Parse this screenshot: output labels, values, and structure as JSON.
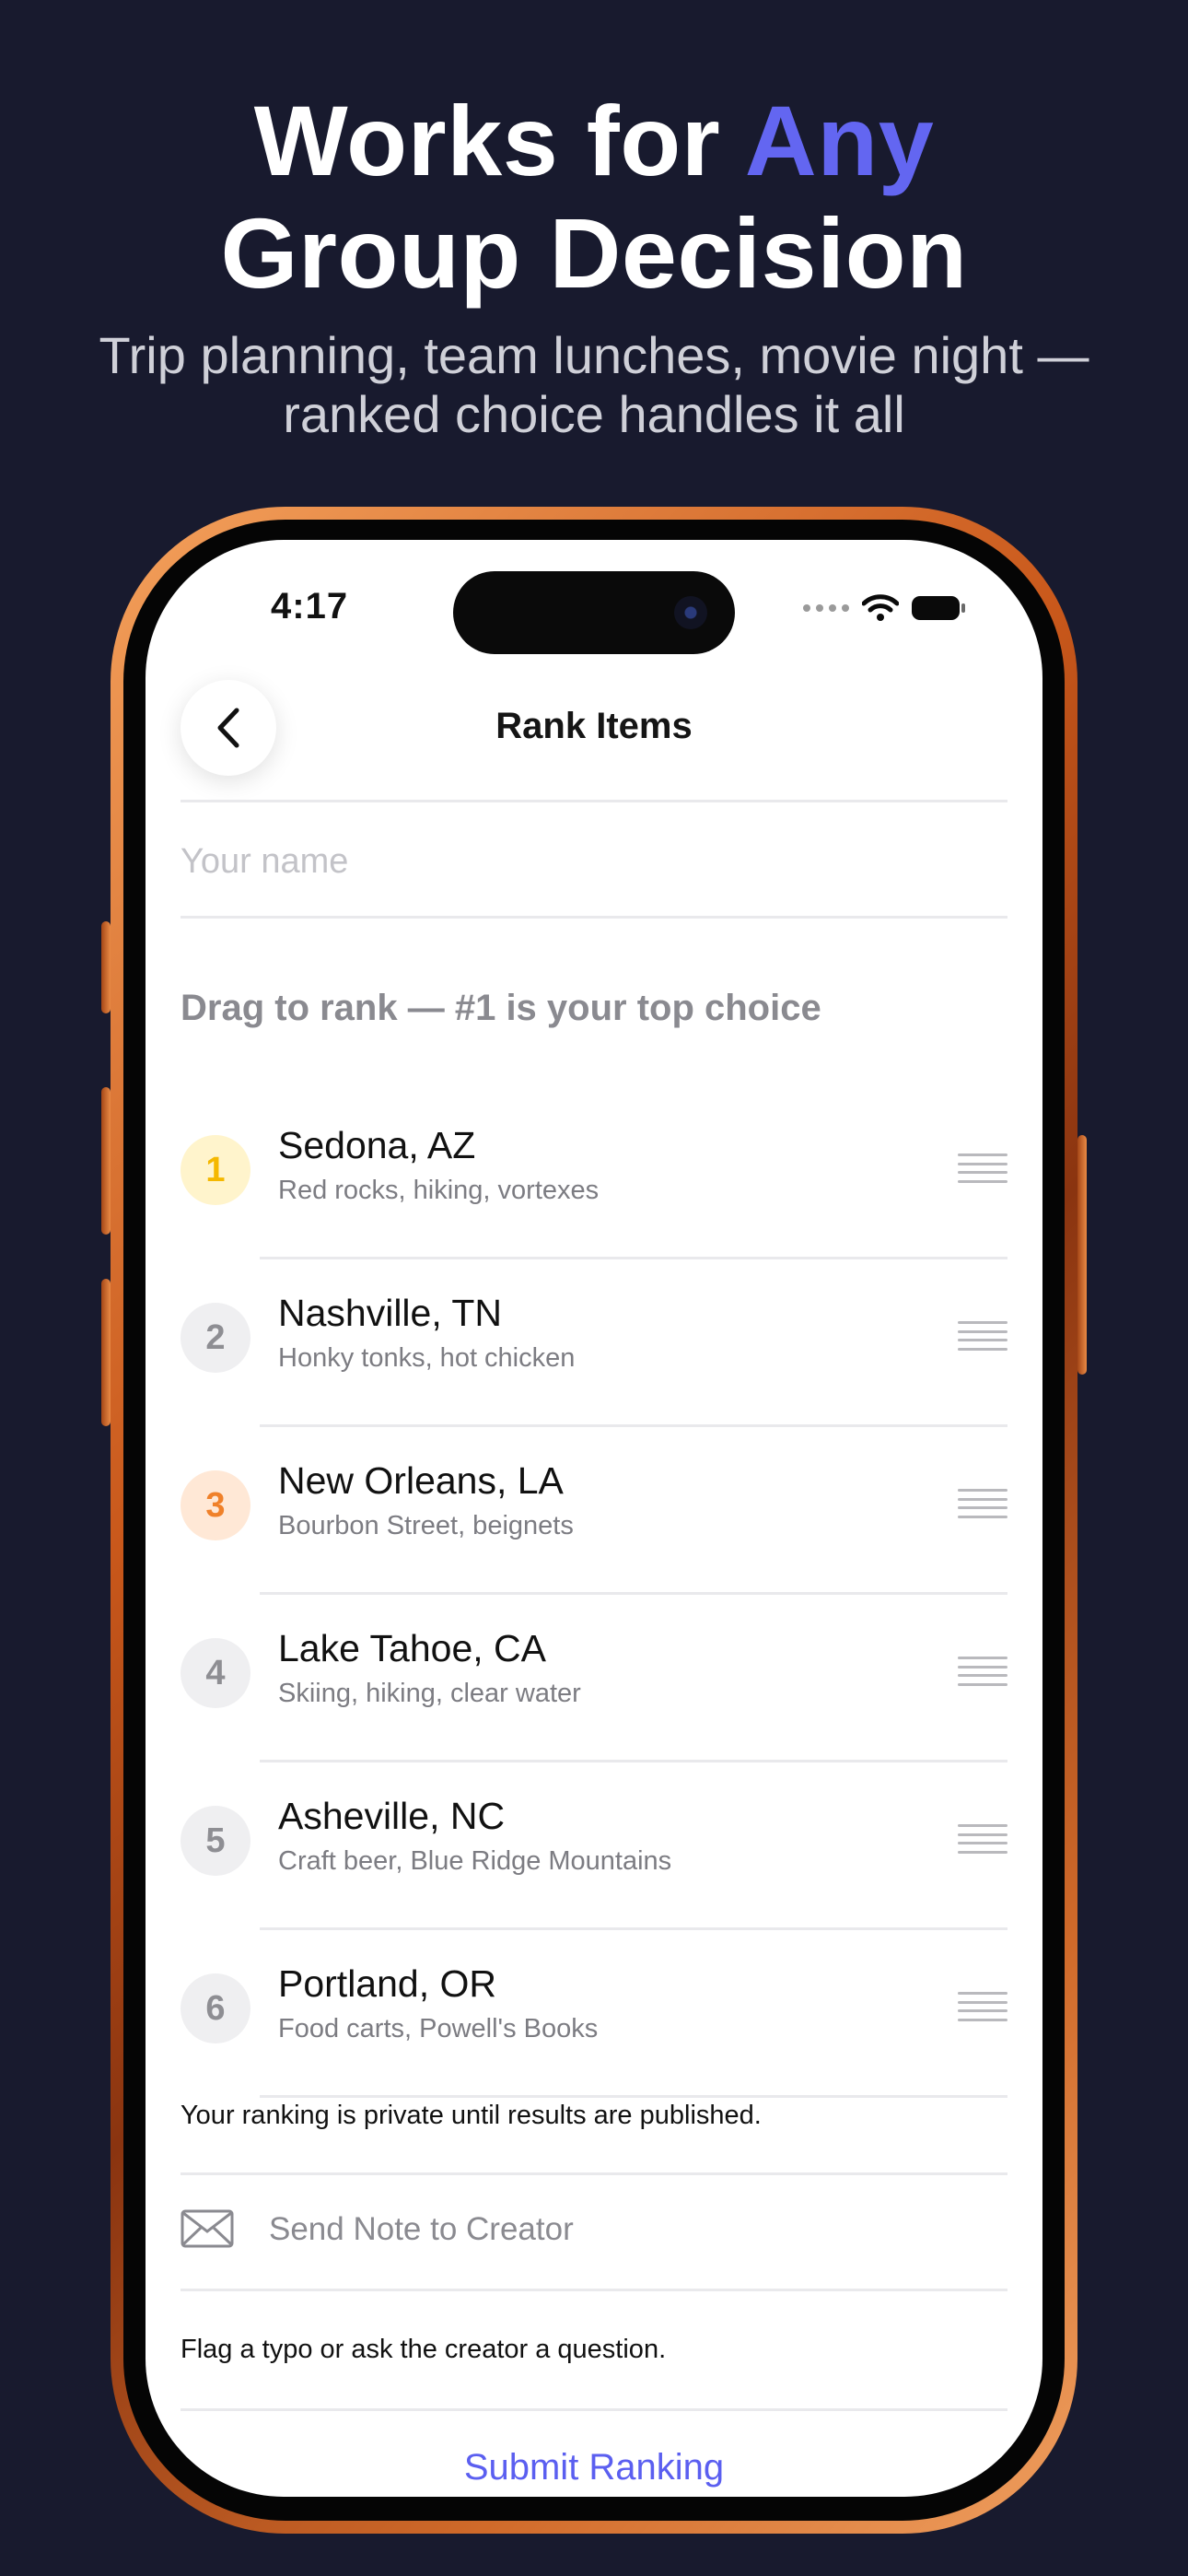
{
  "hero": {
    "title_part1": "Works for ",
    "title_accent": "Any",
    "title_line2": "Group Decision",
    "subtitle_line1": "Trip planning, team lunches, movie night —",
    "subtitle_line2": "ranked choice handles it all",
    "accent_color": "#6366f1"
  },
  "status_bar": {
    "time": "4:17"
  },
  "nav": {
    "title": "Rank Items",
    "back_icon": "chevron-left-icon"
  },
  "name_field": {
    "placeholder": "Your name",
    "value": ""
  },
  "instruction": "Drag to rank — #1 is your top choice",
  "items": [
    {
      "rank": "1",
      "title": "Sedona, AZ",
      "description": "Red rocks, hiking, vortexes",
      "badge_bg": "#fff4cc",
      "badge_color": "#f5b800"
    },
    {
      "rank": "2",
      "title": "Nashville, TN",
      "description": "Honky tonks, hot chicken",
      "badge_bg": "#efeff1",
      "badge_color": "#8e8e93"
    },
    {
      "rank": "3",
      "title": "New Orleans, LA",
      "description": "Bourbon Street, beignets",
      "badge_bg": "#ffe8d6",
      "badge_color": "#f0812a"
    },
    {
      "rank": "4",
      "title": "Lake Tahoe, CA",
      "description": "Skiing, hiking, clear water",
      "badge_bg": "#efeff1",
      "badge_color": "#8e8e93"
    },
    {
      "rank": "5",
      "title": "Asheville, NC",
      "description": "Craft beer, Blue Ridge Mountains",
      "badge_bg": "#efeff1",
      "badge_color": "#8e8e93"
    },
    {
      "rank": "6",
      "title": "Portland, OR",
      "description": "Food carts, Powell's Books",
      "badge_bg": "#efeff1",
      "badge_color": "#8e8e93"
    }
  ],
  "privacy_note": "Your ranking is private until results are published.",
  "note": {
    "label": "Send Note to Creator",
    "icon": "envelope-icon"
  },
  "note_help": "Flag a typo or ask the creator a question.",
  "submit_label": "Submit Ranking"
}
